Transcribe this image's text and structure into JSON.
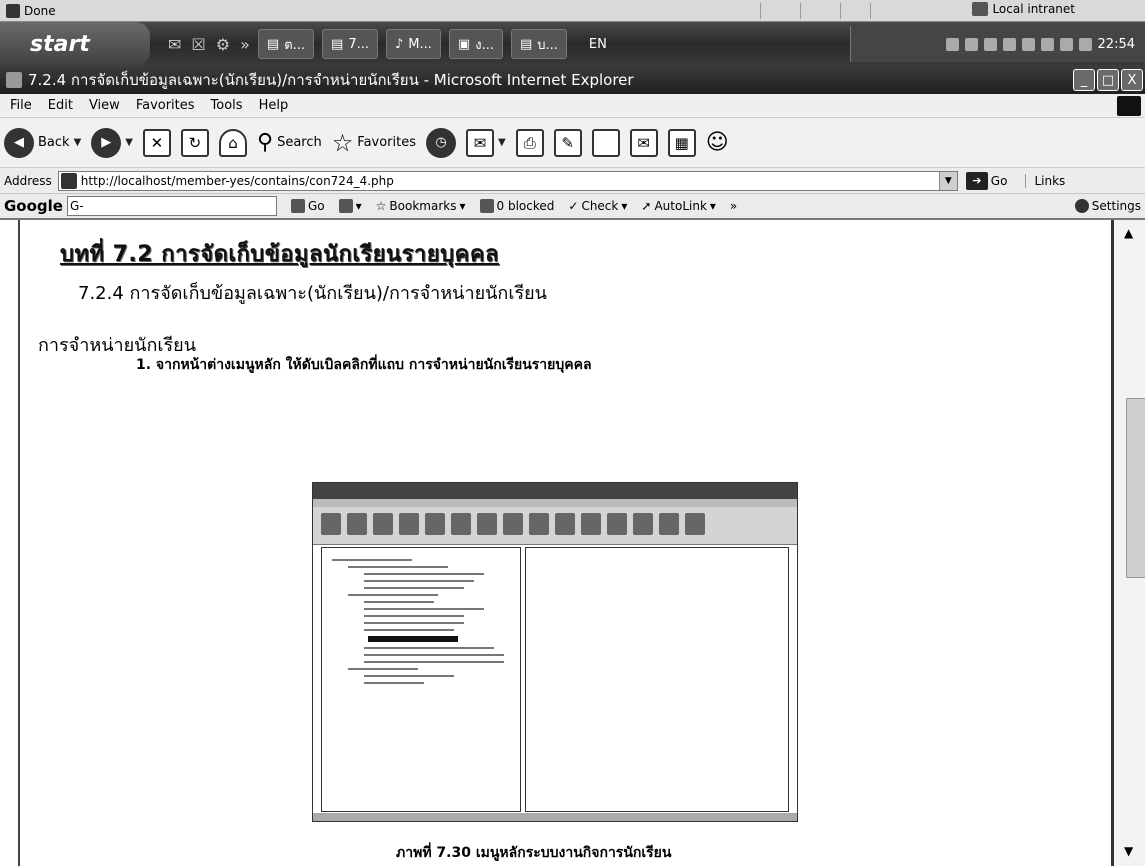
{
  "status_bar": {
    "status": "Done",
    "zone": "Local intranet"
  },
  "taskbar": {
    "start_label": "start",
    "tasks": [
      "ต...",
      "7...",
      "M...",
      "ง...",
      "บ..."
    ],
    "language": "EN",
    "clock": "22:54"
  },
  "window": {
    "title": "7.2.4 การจัดเก็บข้อมูลเฉพาะ(นักเรียน)/การจำหน่ายนักเรียน - Microsoft Internet Explorer",
    "controls": [
      "_",
      "□",
      "X"
    ]
  },
  "menubar": {
    "items": [
      "File",
      "Edit",
      "View",
      "Favorites",
      "Tools",
      "Help"
    ]
  },
  "toolbar": {
    "back_label": "Back",
    "search_label": "Search",
    "favorites_label": "Favorites"
  },
  "address_bar": {
    "label": "Address",
    "url": "http://localhost/member-yes/contains/con724_4.php",
    "go_label": "Go",
    "links_label": "Links"
  },
  "google_toolbar": {
    "logo": "Google",
    "search_value": "G-",
    "go_label": "Go",
    "bookmarks_label": "Bookmarks",
    "blocked_label": "0 blocked",
    "check_label": "Check",
    "autolink_label": "AutoLink",
    "more_label": "»",
    "settings_label": "Settings"
  },
  "content": {
    "page_heading": "บทที่ 7.2 การจัดเก็บข้อมูลนักเรียนรายบุคคล",
    "section_title": "7.2.4 การจัดเก็บข้อมูลเฉพาะ(นักเรียน)/การจำหน่ายนักเรียน",
    "subheading": "การจำหน่ายนักเรียน",
    "step_1": "1. จากหน้าต่างเมนูหลัก ให้ดับเบิลคลิกที่แถบ การจำหน่ายนักเรียนรายบุคคล",
    "caption": "ภาพที่ 7.30 เมนูหลักระบบงานกิจการนักเรียน"
  },
  "colors": {
    "taskbar": "#333333",
    "titlebar": "#2a2a2a",
    "content_bg": "#ffffff"
  }
}
